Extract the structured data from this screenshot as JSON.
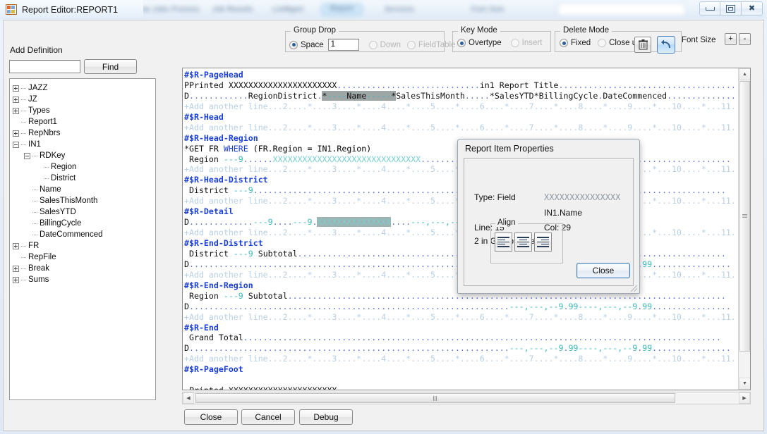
{
  "window": {
    "title": "Report Editor:REPORT1",
    "icon": "app-icon",
    "minimize_label": "–",
    "maximize_label": "□",
    "close_label": "✕"
  },
  "background_tabs": [
    {
      "label": "Show Jobs"
    },
    {
      "label": "Process"
    },
    {
      "label": "Job Results"
    },
    {
      "label": "ListMgmt"
    },
    {
      "label": "Report",
      "selected": true
    },
    {
      "label": "Services"
    },
    {
      "label": "Font Size"
    }
  ],
  "toolbar": {
    "group_drop": {
      "legend": "Group Drop",
      "space_label": "Space",
      "space_value": "1",
      "down_label": "Down",
      "fieldtable_label": "FieldTable",
      "selected": "Space"
    },
    "key_mode": {
      "legend": "Key Mode",
      "overtype_label": "Overtype",
      "insert_label": "Insert",
      "selected": "Overtype"
    },
    "delete_mode": {
      "legend": "Delete Mode",
      "fixed_label": "Fixed",
      "closeup_label": "Close up",
      "selected": "Fixed",
      "trash_icon": "trash-icon",
      "undo_icon": "undo-arrow-icon"
    },
    "font_size": {
      "label": "Font Size",
      "increase_label": "+",
      "decrease_label": "-"
    }
  },
  "left_panel": {
    "add_definition_label": "Add Definition",
    "definition_input_value": "",
    "definition_input_placeholder": "",
    "find_label": "Find",
    "tree": [
      {
        "label": "JAZZ",
        "depth": 0,
        "expander": "plus"
      },
      {
        "label": "JZ",
        "depth": 0,
        "expander": "plus"
      },
      {
        "label": "Types",
        "depth": 0,
        "expander": "plus"
      },
      {
        "label": "Report1",
        "depth": 0,
        "expander": "none"
      },
      {
        "label": "RepNbrs",
        "depth": 0,
        "expander": "plus"
      },
      {
        "label": "IN1",
        "depth": 0,
        "expander": "minus"
      },
      {
        "label": "RDKey",
        "depth": 1,
        "expander": "minus"
      },
      {
        "label": "Region",
        "depth": 2,
        "expander": "none"
      },
      {
        "label": "District",
        "depth": 2,
        "expander": "none"
      },
      {
        "label": "Name",
        "depth": 1,
        "expander": "none"
      },
      {
        "label": "SalesThisMonth",
        "depth": 1,
        "expander": "none"
      },
      {
        "label": "SalesYTD",
        "depth": 1,
        "expander": "none"
      },
      {
        "label": "BillingCycle",
        "depth": 1,
        "expander": "none"
      },
      {
        "label": "DateCommenced",
        "depth": 1,
        "expander": "none"
      },
      {
        "label": "FR",
        "depth": 0,
        "expander": "plus"
      },
      {
        "label": "RepFile",
        "depth": 0,
        "expander": "none"
      },
      {
        "label": "Break",
        "depth": 0,
        "expander": "plus"
      },
      {
        "label": "Sums",
        "depth": 0,
        "expander": "plus"
      }
    ]
  },
  "editor": {
    "ruler": "+Add another line...2....*....3....*....4....*....5....*....6....*....7....*....8....*....9....*...10....*...11.",
    "lines": [
      {
        "kind": "section",
        "text": "#$R-PageHead"
      },
      {
        "kind": "content",
        "text": "PPrinted XXXXXXXXXXXXXXXXXXXXXX.............................in1 Report Title.........................................."
      },
      {
        "kind": "content",
        "text": "D............RegionDistrict.*----Name-----*SalesThisMonth.....*SalesYTD*BillingCycle.DateCommenced................."
      },
      {
        "kind": "ruler"
      },
      {
        "kind": "section",
        "text": "#$R-Head"
      },
      {
        "kind": "ruler"
      },
      {
        "kind": "section",
        "text": "#$R-Head-Region"
      },
      {
        "kind": "code",
        "text": "*GET FR WHERE (FR.Region = IN1.Region)"
      },
      {
        "kind": "content",
        "text": " Region ---9......XXXXXXXXXXXXXXXXXXXXXXXXXXXXXX..............................................................."
      },
      {
        "kind": "ruler"
      },
      {
        "kind": "section",
        "text": "#$R-Head-District"
      },
      {
        "kind": "content",
        "text": " District ---9................................................................................................"
      },
      {
        "kind": "ruler"
      },
      {
        "kind": "section",
        "text": "#$R-Detail"
      },
      {
        "kind": "content",
        "text": "D.............---9....---9.XXXXXXXXXXXXXXX....---,---,--9...."
      },
      {
        "kind": "ruler"
      },
      {
        "kind": "section",
        "text": "#$R-End-District"
      },
      {
        "kind": "content",
        "text": " District ---9 Subtotal......................................................................................."
      },
      {
        "kind": "content",
        "text": "D.................................................................---,---,--9.99----,---,--9.99................"
      },
      {
        "kind": "ruler"
      },
      {
        "kind": "section",
        "text": "#$R-End-Region"
      },
      {
        "kind": "content",
        "text": " Region ---9 Subtotal........................................................................................."
      },
      {
        "kind": "content",
        "text": "D.................................................................---,---,--9.99----,---,--9.99................"
      },
      {
        "kind": "ruler"
      },
      {
        "kind": "section",
        "text": "#$R-End"
      },
      {
        "kind": "content",
        "text": " Grand Total................................................................................................."
      },
      {
        "kind": "content",
        "text": "D.................................................................---,---,--9.99----,---,--9.99................"
      },
      {
        "kind": "ruler"
      },
      {
        "kind": "section",
        "text": "#$R-PageFoot"
      },
      {
        "kind": "blank",
        "text": ""
      },
      {
        "kind": "content",
        "text": " Printed XXXXXXXXXXXXXXXXXXXXXX.................................................."
      },
      {
        "kind": "ruler"
      }
    ],
    "selected_field_pagehead": "*----Name-----*",
    "selected_field_detail": "XXXXXXXXXXXXXXX"
  },
  "dialog": {
    "title": "Report Item Properties",
    "type_label": "Type: Field",
    "field_mask": "XXXXXXXXXXXXXXX",
    "field_name": "IN1.Name",
    "line_label": "Line: 15",
    "col_label": "Col: 29",
    "group_label": "2 in Group, Index:4",
    "align": {
      "legend": "Align",
      "left_icon": "align-left-icon",
      "center_icon": "align-center-icon",
      "right_icon": "align-right-icon"
    },
    "close_label": "Close"
  },
  "bottom_buttons": {
    "close_label": "Close",
    "cancel_label": "Cancel",
    "debug_label": "Debug"
  },
  "scrollbars": {
    "v_up_icon": "triangle-up-icon",
    "v_down_icon": "triangle-down-icon",
    "h_left_icon": "triangle-left-icon",
    "h_right_icon": "triangle-right-icon"
  },
  "colors": {
    "section": "#1a3fd8",
    "xfield": "#79cfd2",
    "dots": "#5d6cd8",
    "ruler": "#b9cfe3",
    "selection": "#9fa6a6",
    "accent": "#2a6099"
  }
}
